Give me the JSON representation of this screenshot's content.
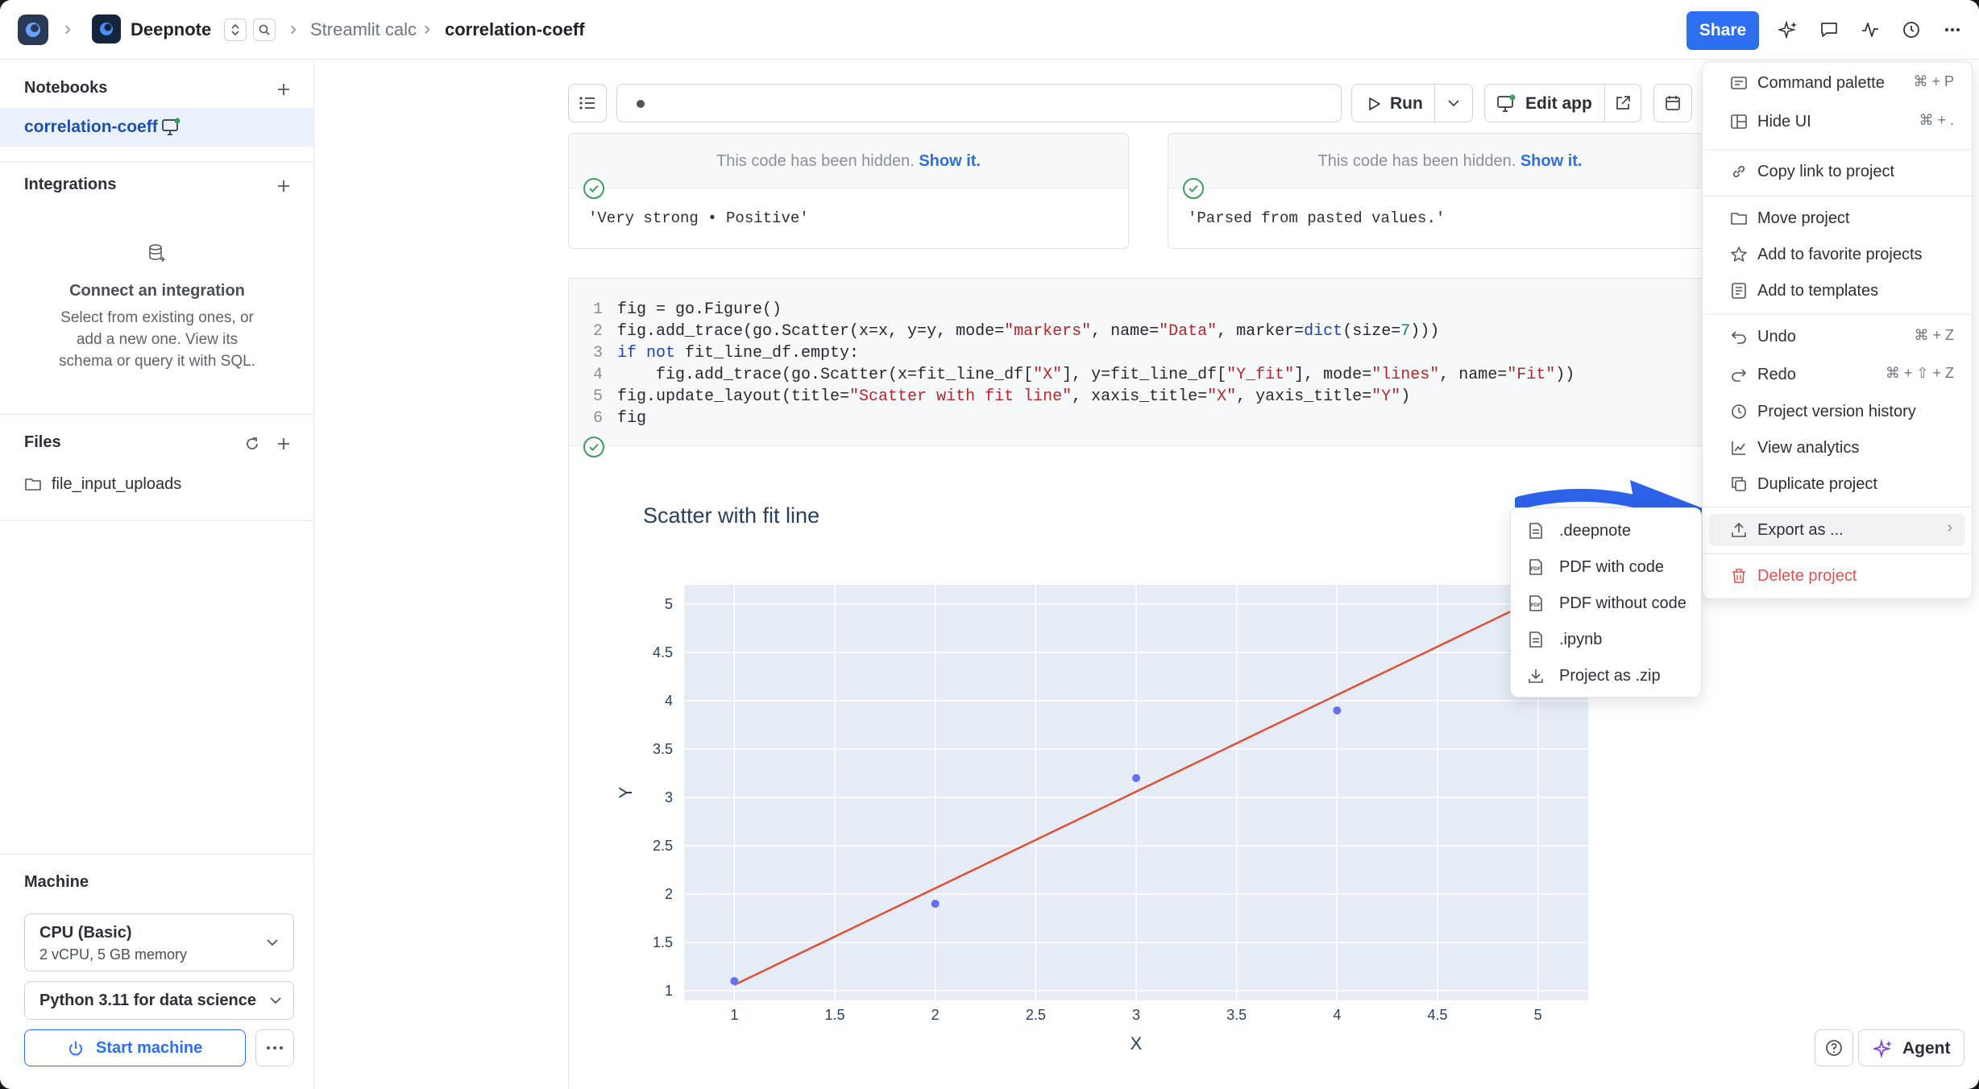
{
  "topbar": {
    "workspace": "Deepnote",
    "project": "Streamlit calc",
    "notebook": "correlation-coeff",
    "share_label": "Share"
  },
  "sidebar": {
    "notebooks_heading": "Notebooks",
    "notebook_item": "correlation-coeff",
    "integrations_heading": "Integrations",
    "connect_title": "Connect an integration",
    "connect_lines": [
      "Select from existing ones, or",
      "add a new one. View its",
      "schema or query it with SQL."
    ],
    "files_heading": "Files",
    "file_item": "file_input_uploads",
    "machine_heading": "Machine",
    "machine_name": "CPU (Basic)",
    "machine_specs": "2 vCPU, 5 GB memory",
    "python_env": "Python 3.11 for data science",
    "start_label": "Start machine"
  },
  "toolbar": {
    "run_label": "Run",
    "edit_app_label": "Edit app"
  },
  "cells": {
    "hidden_text": "This code has been hidden.",
    "show_link": "Show it.",
    "output_1": "'Very strong • Positive'",
    "output_2": "'Parsed from pasted values.'"
  },
  "code": {
    "numbers": [
      "1",
      "2",
      "3",
      "4",
      "5",
      "6"
    ]
  },
  "menu": {
    "items": [
      {
        "label": "Command palette",
        "shortcut": "⌘ + P"
      },
      {
        "label": "Hide UI",
        "shortcut": "⌘ + ."
      },
      {
        "label": "Copy link to project"
      },
      {
        "label": "Move project"
      },
      {
        "label": "Add to favorite projects"
      },
      {
        "label": "Add to templates"
      },
      {
        "label": "Undo",
        "shortcut": "⌘ + Z"
      },
      {
        "label": "Redo",
        "shortcut": "⌘ + ⇧ + Z"
      },
      {
        "label": "Project version history"
      },
      {
        "label": "View analytics"
      },
      {
        "label": "Duplicate project"
      },
      {
        "label": "Export as ..."
      },
      {
        "label": "Delete project"
      }
    ],
    "export_submenu": [
      ".deepnote",
      "PDF with code",
      "PDF without code",
      ".ipynb",
      "Project as .zip"
    ]
  },
  "agent_label": "Agent",
  "colors": {
    "accent": "#2d6ff0",
    "fit_line": "#e0513c",
    "points": "#636efa",
    "plot_bg": "#e5ecf6",
    "delete": "#d9534f"
  },
  "chart_data": {
    "type": "scatter",
    "title": "Scatter with fit line",
    "xlabel": "X",
    "ylabel": "Y",
    "xlim": [
      0.75,
      5.25
    ],
    "ylim": [
      0.9,
      5.2
    ],
    "xticks": [
      "1",
      "1.5",
      "2",
      "2.5",
      "3",
      "3.5",
      "4",
      "4.5",
      "5"
    ],
    "yticks": [
      "1",
      "1.5",
      "2",
      "2.5",
      "3",
      "3.5",
      "4",
      "4.5",
      "5"
    ],
    "grid": true,
    "series": [
      {
        "name": "Data",
        "mode": "markers",
        "x": [
          1,
          2,
          3,
          4,
          5
        ],
        "y": [
          1.1,
          1.9,
          3.2,
          3.9,
          5.0
        ]
      },
      {
        "name": "Fit",
        "mode": "lines",
        "x": [
          1,
          5
        ],
        "y": [
          1.06,
          5.06
        ]
      }
    ]
  }
}
